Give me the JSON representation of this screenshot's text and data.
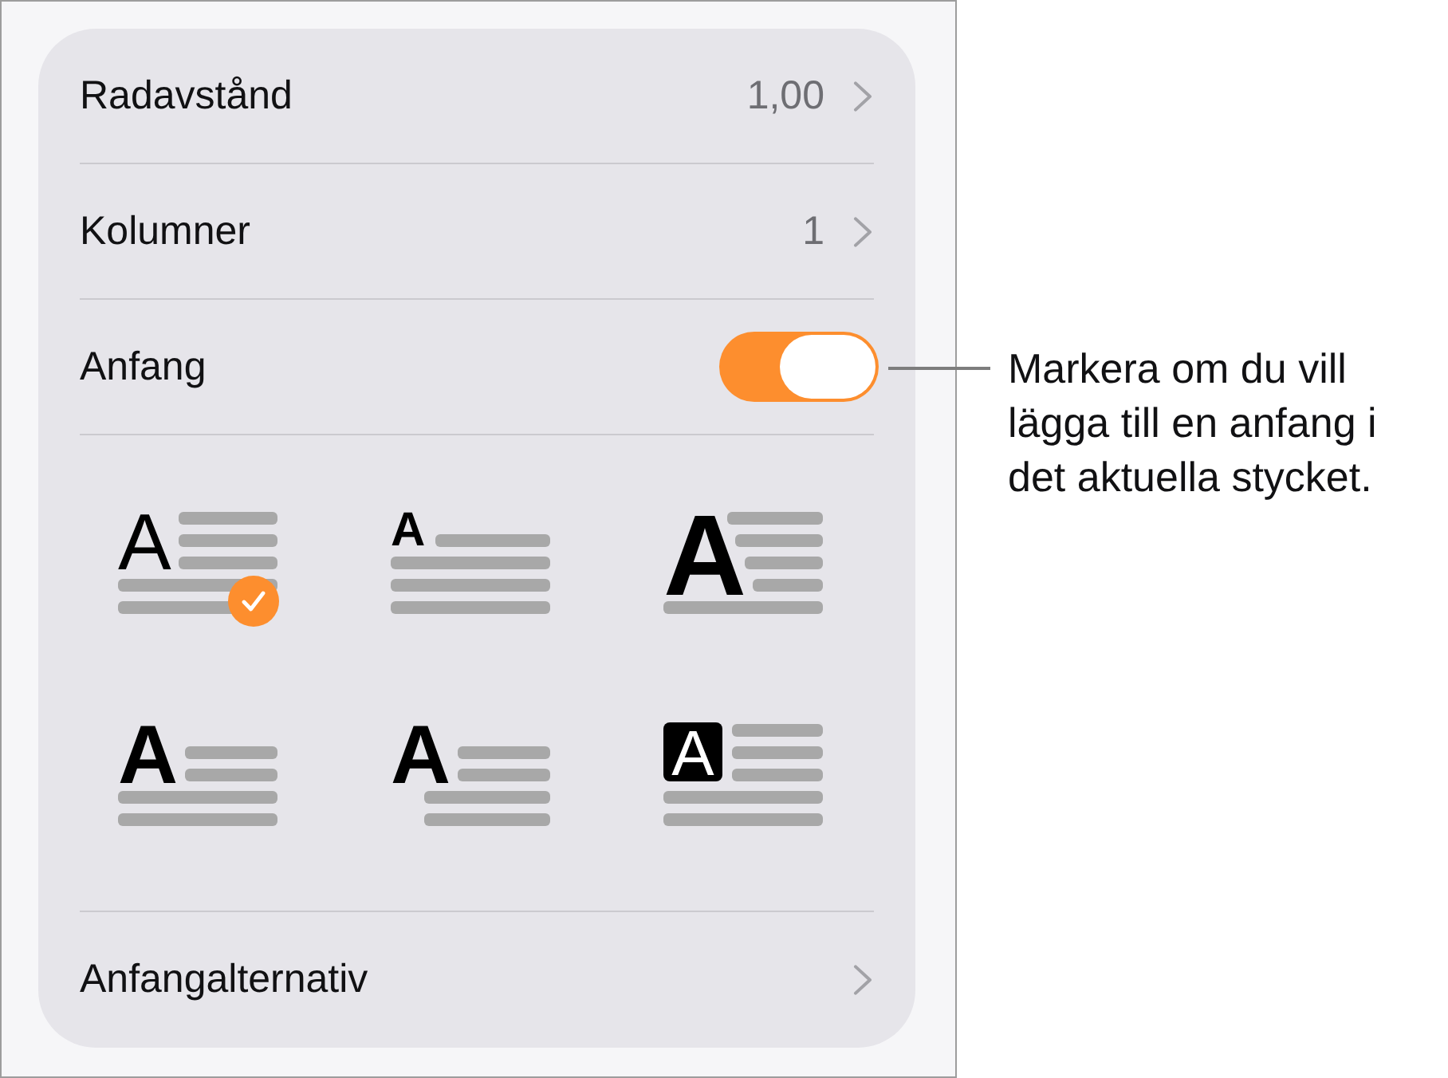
{
  "settings": [
    {
      "kind": "value",
      "label": "Radavstånd",
      "value": "1,00"
    },
    {
      "kind": "value",
      "label": "Kolumner",
      "value": "1"
    },
    {
      "kind": "switch",
      "label": "Anfang",
      "on": true
    }
  ],
  "drop_cap_styles": [
    {
      "kind": "plain",
      "glyph": "A",
      "selected": true
    },
    {
      "kind": "small",
      "glyph": "A",
      "selected": false
    },
    {
      "kind": "large-bold",
      "glyph": "A",
      "selected": false
    },
    {
      "kind": "bold",
      "glyph": "A",
      "selected": false
    },
    {
      "kind": "bold-indented",
      "glyph": "A",
      "selected": false
    },
    {
      "kind": "boxed",
      "glyph": "A",
      "selected": false
    }
  ],
  "footer_row": {
    "label": "Anfangalternativ"
  },
  "callout": {
    "text": "Markera om du vill lägga till en anfang i det aktuella stycket."
  }
}
